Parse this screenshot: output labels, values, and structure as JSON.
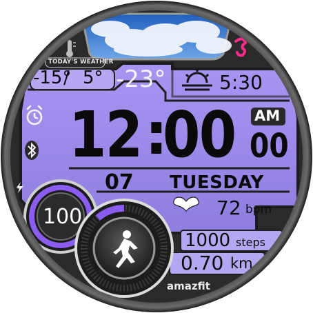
{
  "weather": {
    "label": "TODAY'S WEATHER",
    "high": "-15°",
    "low": "5°",
    "current": "-23°",
    "sky_icon": "cloudy-sky-image"
  },
  "sun": {
    "icon": "sunset-icon",
    "time": "5:30"
  },
  "time": {
    "hours": "12",
    "separator": ":",
    "minutes": "00",
    "ampm": "AM",
    "seconds": "00"
  },
  "date": {
    "day": "07",
    "weekday": "TUESDAY"
  },
  "heart": {
    "value": "72",
    "unit": "bpm"
  },
  "battery": {
    "value": "100",
    "level_percent": 100
  },
  "steps": {
    "value": "1000",
    "unit": "steps",
    "goal_progress_percent": 12
  },
  "distance": {
    "value": "0.70",
    "unit": "km"
  },
  "brand": "amazfit",
  "colors": {
    "lcd": "#9d8cea",
    "accent_purple": "#8a5cf0",
    "ring_magenta": "#ff2d8a"
  },
  "icons": [
    "thermometer-icon",
    "alarm-icon",
    "bluetooth-icon",
    "charge-icon",
    "heart-icon",
    "runner-icon",
    "app-logo-icon"
  ]
}
